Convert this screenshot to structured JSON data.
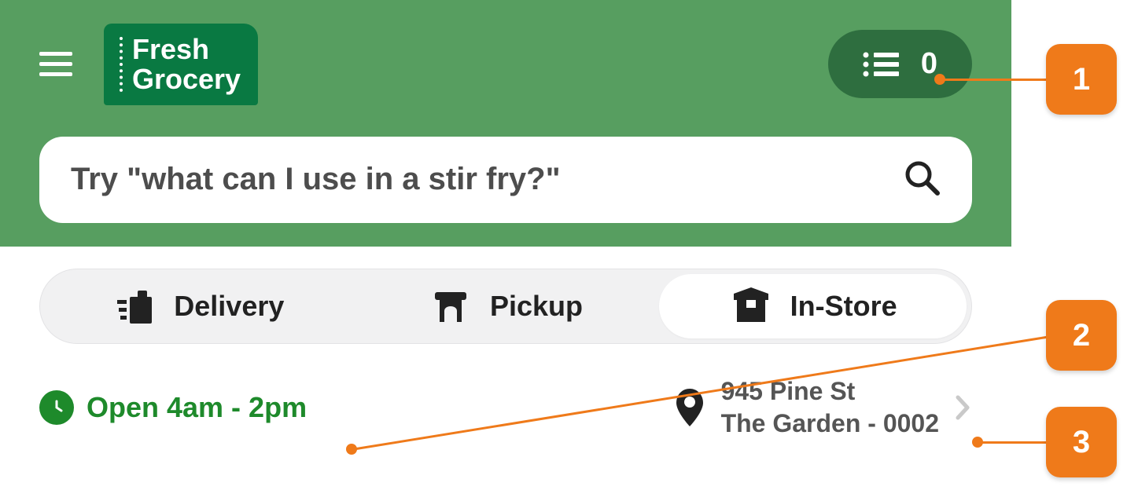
{
  "header": {
    "logo_line1": "Fresh",
    "logo_line2": "Grocery",
    "cart_count": "0"
  },
  "search": {
    "placeholder": "Try \"what can I use in a stir fry?\""
  },
  "modes": {
    "delivery": "Delivery",
    "pickup": "Pickup",
    "instore": "In-Store",
    "active": "instore"
  },
  "store": {
    "hours_label": "Open 4am - 2pm",
    "address_line1": "945 Pine St",
    "address_line2": "The Garden - 0002"
  },
  "callouts": {
    "n1": "1",
    "n2": "2",
    "n3": "3"
  }
}
